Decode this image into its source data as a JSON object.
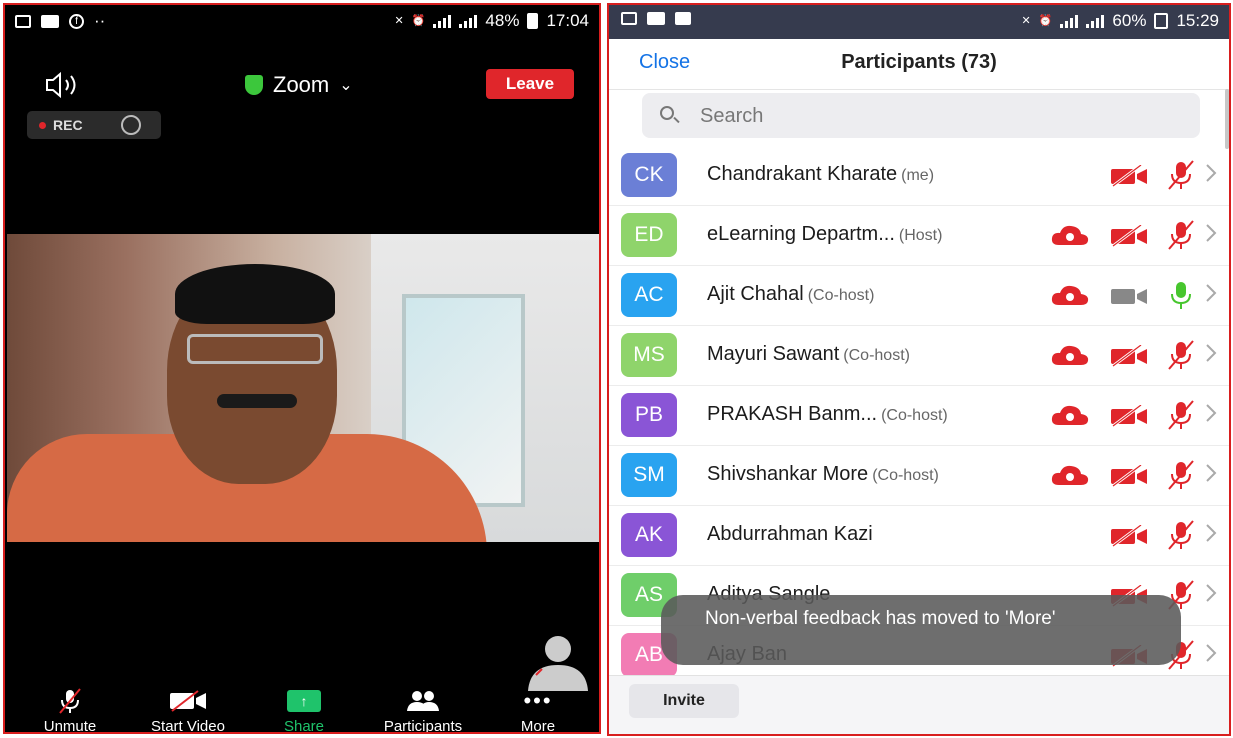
{
  "left": {
    "status": {
      "battery": "48%",
      "time": "17:04"
    },
    "title": "Zoom",
    "leave_label": "Leave",
    "rec_label": "REC",
    "toolbar": [
      {
        "label": "Unmute",
        "icon": "mic-muted-icon"
      },
      {
        "label": "Start Video",
        "icon": "video-off-icon"
      },
      {
        "label": "Share",
        "icon": "share-icon"
      },
      {
        "label": "Participants",
        "icon": "participants-icon"
      },
      {
        "label": "More",
        "icon": "more-icon"
      }
    ]
  },
  "right": {
    "status": {
      "battery": "60%",
      "time": "15:29"
    },
    "close_label": "Close",
    "title": "Participants (73)",
    "search_placeholder": "Search",
    "participants": [
      {
        "initials": "CK",
        "name": "Chandrakant Kharate",
        "role": "(me)",
        "color": "#6b7fd6",
        "cloud": false,
        "video": "off",
        "mic": "muted"
      },
      {
        "initials": "ED",
        "name": "eLearning Departm...",
        "role": "(Host)",
        "color": "#8fd46b",
        "cloud": true,
        "video": "off",
        "mic": "muted"
      },
      {
        "initials": "AC",
        "name": "Ajit Chahal",
        "role": "(Co-host)",
        "color": "#29a3f0",
        "cloud": true,
        "video": "on",
        "mic": "on"
      },
      {
        "initials": "MS",
        "name": "Mayuri Sawant",
        "role": "(Co-host)",
        "color": "#8fd46b",
        "cloud": true,
        "video": "off",
        "mic": "muted"
      },
      {
        "initials": "PB",
        "name": "PRAKASH Banm...",
        "role": "(Co-host)",
        "color": "#8a55d6",
        "cloud": true,
        "video": "off",
        "mic": "muted"
      },
      {
        "initials": "SM",
        "name": "Shivshankar More",
        "role": "(Co-host)",
        "color": "#29a3f0",
        "cloud": true,
        "video": "off",
        "mic": "muted"
      },
      {
        "initials": "AK",
        "name": "Abdurrahman Kazi",
        "role": "",
        "color": "#8a55d6",
        "cloud": false,
        "video": "off",
        "mic": "muted"
      },
      {
        "initials": "AS",
        "name": "Aditya Sangle",
        "role": "",
        "color": "#6fce6a",
        "cloud": false,
        "video": "off",
        "mic": "muted"
      },
      {
        "initials": "AB",
        "name": "Ajay Ban",
        "role": "",
        "color": "#f27cb4",
        "cloud": false,
        "video": "off",
        "mic": "muted"
      }
    ],
    "toast": "Non-verbal feedback has moved to 'More'",
    "invite_label": "Invite"
  },
  "colors": {
    "accent": "#1473e6",
    "danger": "#e0262b",
    "share_green": "#1fc36b",
    "mic_on": "#47c62e"
  }
}
